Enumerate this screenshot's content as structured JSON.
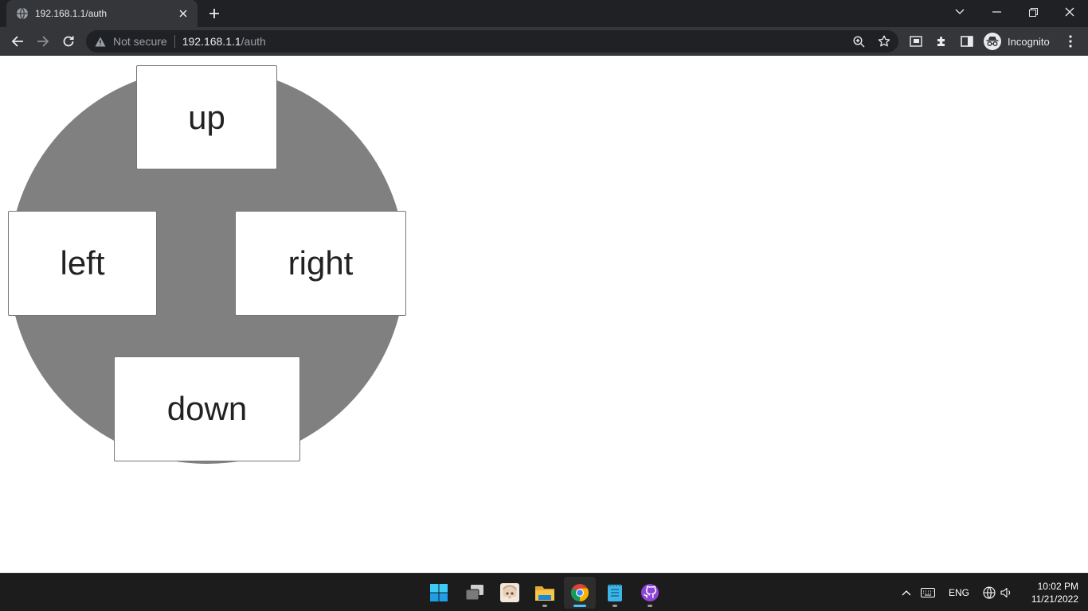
{
  "browser": {
    "tab": {
      "title": "192.168.1.1/auth",
      "favicon": "globe-icon"
    },
    "security_label": "Not secure",
    "url_host": "192.168.1.1",
    "url_path": "/auth",
    "profile_label": "Incognito",
    "colors": {
      "frame": "#202124",
      "toolbar": "#35363a",
      "omnibox": "#202124"
    }
  },
  "page": {
    "dpad": {
      "up_label": "up",
      "left_label": "left",
      "right_label": "right",
      "down_label": "down",
      "circle_color": "#808080"
    }
  },
  "taskbar": {
    "apps": [
      "start-icon",
      "task-view-icon",
      "anime-app-icon",
      "file-explorer-icon",
      "chrome-icon",
      "notepad-icon",
      "github-desktop-icon"
    ],
    "language": "ENG",
    "time": "10:02 PM",
    "date": "11/21/2022"
  }
}
